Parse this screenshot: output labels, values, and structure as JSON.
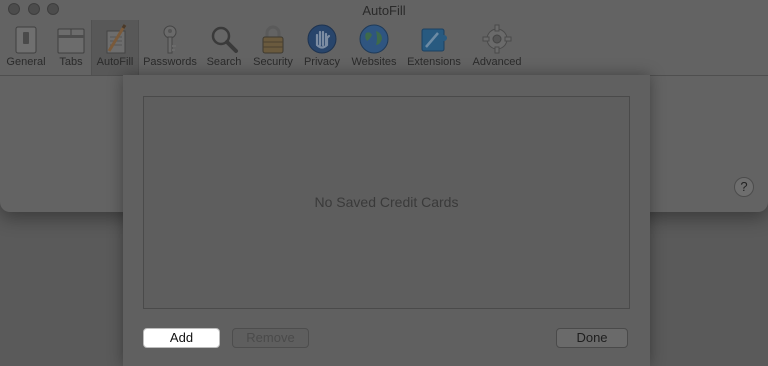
{
  "window": {
    "title": "AutoFill"
  },
  "toolbar": {
    "items": [
      {
        "label": "General",
        "icon": "general-switch-icon"
      },
      {
        "label": "Tabs",
        "icon": "tabs-icon"
      },
      {
        "label": "AutoFill",
        "icon": "autofill-pencil-icon",
        "selected": true
      },
      {
        "label": "Passwords",
        "icon": "key-icon"
      },
      {
        "label": "Search",
        "icon": "magnifier-icon"
      },
      {
        "label": "Security",
        "icon": "padlock-icon"
      },
      {
        "label": "Privacy",
        "icon": "hand-icon"
      },
      {
        "label": "Websites",
        "icon": "globe-icon"
      },
      {
        "label": "Extensions",
        "icon": "puzzle-icon"
      },
      {
        "label": "Advanced",
        "icon": "gear-icon"
      }
    ]
  },
  "help": {
    "label": "?"
  },
  "sheet": {
    "empty_message": "No Saved Credit Cards",
    "add_label": "Add",
    "remove_label": "Remove",
    "done_label": "Done"
  }
}
